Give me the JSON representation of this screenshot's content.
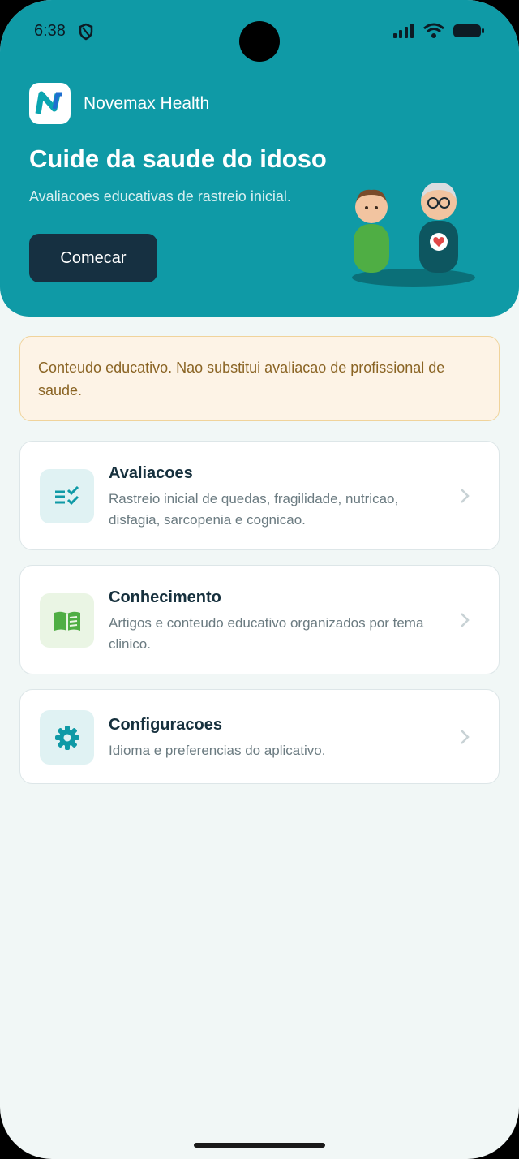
{
  "status_bar": {
    "time": "6:38"
  },
  "header": {
    "app_name": "Novemax Health",
    "title": "Cuide da saude do idoso",
    "subtitle": "Avaliacoes educativas de rastreio inicial.",
    "start_label": "Comecar"
  },
  "notice": {
    "text": "Conteudo educativo. Nao substitui avaliacao de profissional de saude."
  },
  "menu": {
    "items": [
      {
        "title": "Avaliacoes",
        "description": "Rastreio inicial de quedas, fragilidade, nutricao, disfagia, sarcopenia e cognicao.",
        "icon": "checklist-icon"
      },
      {
        "title": "Conhecimento",
        "description": "Artigos e conteudo educativo organizados por tema clinico.",
        "icon": "book-icon"
      },
      {
        "title": "Configuracoes",
        "description": "Idioma e preferencias do aplicativo.",
        "icon": "gear-icon"
      }
    ]
  },
  "colors": {
    "primary": "#0f9aa6",
    "dark": "#163041",
    "notice_bg": "#fdf3e6",
    "notice_text": "#8a6424"
  }
}
